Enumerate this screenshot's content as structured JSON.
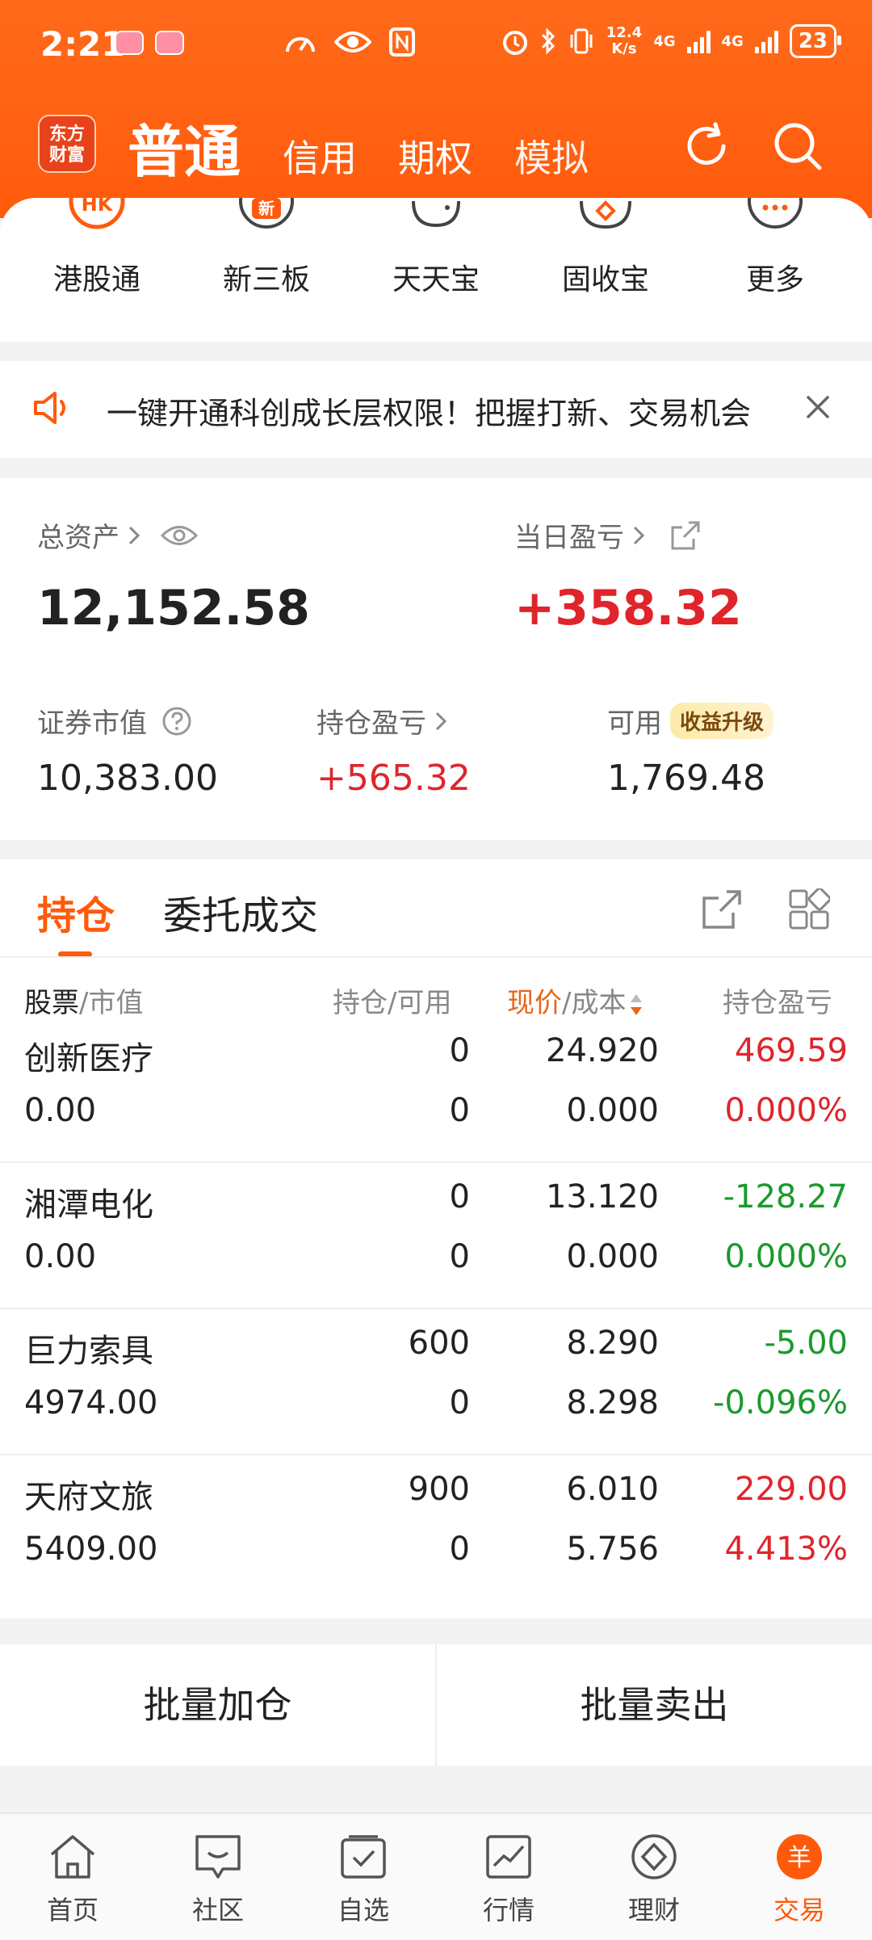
{
  "status_bar": {
    "time": "2:21",
    "net_speed_value": "12.4",
    "net_speed_unit": "K/s",
    "net_type_1": "4G",
    "net_type_2": "4G",
    "battery": "23"
  },
  "header": {
    "logo_line1": "东方",
    "logo_line2": "财富",
    "tabs": [
      {
        "label": "普通"
      },
      {
        "label": "信用"
      },
      {
        "label": "期权"
      },
      {
        "label": "模拟"
      }
    ]
  },
  "quick_menu": {
    "items": [
      {
        "label": "港股通",
        "icon_text": "HK"
      },
      {
        "label": "新三板",
        "icon_text": "新"
      },
      {
        "label": "天天宝"
      },
      {
        "label": "固收宝"
      },
      {
        "label": "更多"
      }
    ]
  },
  "notice": {
    "text": "一键开通科创成长层权限！把握打新、交易机会"
  },
  "assets": {
    "total_label": "总资产",
    "total_value": "12,152.58",
    "daily_pl_label": "当日盈亏",
    "daily_pl_value": "+358.32",
    "market_value_label": "证券市值",
    "market_value": "10,383.00",
    "holding_pl_label": "持仓盈亏",
    "holding_pl_value": "+565.32",
    "available_label": "可用",
    "available_badge": "收益升级",
    "available_value": "1,769.48"
  },
  "positions": {
    "tab_holdings": "持仓",
    "tab_orders": "委托成交",
    "headers": {
      "stock": "股票",
      "market_value": "/市值",
      "holding": "持仓/可用",
      "price": "现价",
      "cost": "/成本",
      "pl": "持仓盈亏"
    },
    "rows": [
      {
        "name": "创新医疗",
        "value": "0.00",
        "qty": "0",
        "avail": "0",
        "price": "24.920",
        "cost": "0.000",
        "pl": "469.59",
        "pct": "0.000%",
        "color": "#e0242b"
      },
      {
        "name": "湘潭电化",
        "value": "0.00",
        "qty": "0",
        "avail": "0",
        "price": "13.120",
        "cost": "0.000",
        "pl": "-128.27",
        "pct": "0.000%",
        "color": "#1a9a2c"
      },
      {
        "name": "巨力索具",
        "value": "4974.00",
        "qty": "600",
        "avail": "0",
        "price": "8.290",
        "cost": "8.298",
        "pl": "-5.00",
        "pct": "-0.096%",
        "color": "#1a9a2c"
      },
      {
        "name": "天府文旅",
        "value": "5409.00",
        "qty": "900",
        "avail": "0",
        "price": "6.010",
        "cost": "5.756",
        "pl": "229.00",
        "pct": "4.413%",
        "color": "#e0242b"
      }
    ]
  },
  "batch": {
    "add": "批量加仓",
    "sell": "批量卖出"
  },
  "bottom_nav": {
    "items": [
      {
        "label": "首页"
      },
      {
        "label": "社区"
      },
      {
        "label": "自选"
      },
      {
        "label": "行情"
      },
      {
        "label": "理财"
      },
      {
        "label": "交易",
        "icon_text": "羊"
      }
    ]
  },
  "colors": {
    "brand": "#ff5a0c",
    "up": "#e0242b",
    "down": "#1a9a2c"
  }
}
